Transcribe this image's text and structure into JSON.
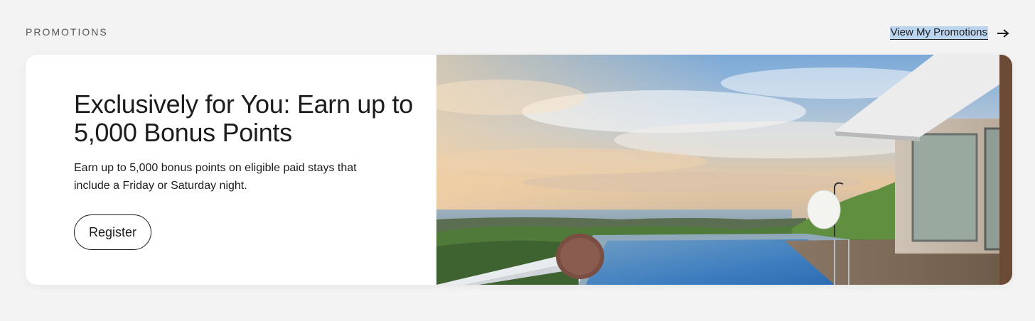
{
  "section": {
    "label": "PROMOTIONS",
    "view_link": "View My Promotions",
    "view_link_icon": "arrow-right-icon"
  },
  "promo": {
    "title": "Exclusively for You: Earn up to 5,000 Bonus Points",
    "description": "Earn up to 5,000 bonus points on eligible paid stays that include a Friday or Saturday night.",
    "register_label": "Register",
    "image": "infinity-pool-villa-ocean-view"
  },
  "colors": {
    "background": "#f3f3f3",
    "card": "#ffffff",
    "text": "#1c1c1c",
    "link_highlight": "#bcd5ee"
  }
}
